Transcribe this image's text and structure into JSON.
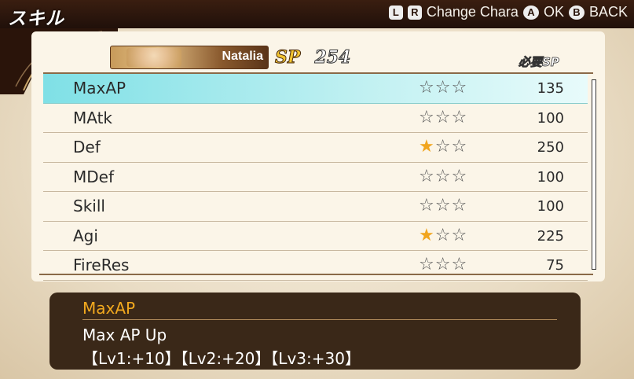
{
  "header": {
    "title": "スキル",
    "controls": {
      "l_glyph": "L",
      "r_glyph": "R",
      "change_label": "Change Chara",
      "a_glyph": "A",
      "ok_label": "OK",
      "b_glyph": "B",
      "back_label": "BACK"
    }
  },
  "character": {
    "name": "Natalia",
    "sp_label": "SP",
    "sp_value": "254"
  },
  "list_header": {
    "cost_label": "必要SP"
  },
  "skills": [
    {
      "name": "MaxAP",
      "stars": 0,
      "cost": "135"
    },
    {
      "name": "MAtk",
      "stars": 0,
      "cost": "100"
    },
    {
      "name": "Def",
      "stars": 1,
      "cost": "250"
    },
    {
      "name": "MDef",
      "stars": 0,
      "cost": "100"
    },
    {
      "name": "Skill",
      "stars": 0,
      "cost": "100"
    },
    {
      "name": "Agi",
      "stars": 1,
      "cost": "225"
    },
    {
      "name": "FireRes",
      "stars": 0,
      "cost": "75"
    }
  ],
  "description": {
    "title": "MaxAP",
    "line1": "Max AP Up",
    "line2": "【Lv1:+10】【Lv2:+20】【Lv3:+30】"
  },
  "colors": {
    "selected_row": "#7fe0e6",
    "star_filled": "#f1a51e",
    "desc_title": "#f2a91e"
  }
}
